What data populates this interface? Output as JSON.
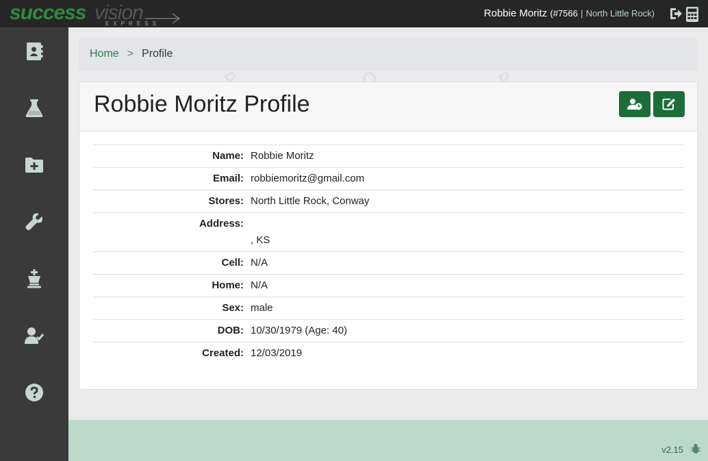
{
  "brand": {
    "logo_part1": "success",
    "logo_part2": "vision",
    "logo_sub": "EXPRESS"
  },
  "header": {
    "user_name": "Robbie Moritz",
    "user_number": "(#7566",
    "separator": "|",
    "store": "North Little Rock)",
    "icons": [
      "logout-icon",
      "calculator-icon"
    ]
  },
  "sidebar": {
    "items": [
      {
        "icon": "address-book-icon"
      },
      {
        "icon": "flask-icon"
      },
      {
        "icon": "folder-plus-icon"
      },
      {
        "icon": "wrench-icon"
      },
      {
        "icon": "chess-king-icon"
      },
      {
        "icon": "user-check-icon"
      },
      {
        "icon": "question-circle-icon"
      }
    ]
  },
  "breadcrumb": {
    "home": "Home",
    "separator": ">",
    "current": "Profile"
  },
  "profile": {
    "title": "Robbie Moritz Profile",
    "buttons": {
      "history_icon": "user-clock-icon",
      "edit_icon": "edit-icon"
    },
    "fields": [
      {
        "label": "Name:",
        "value": "Robbie Moritz"
      },
      {
        "label": "Email:",
        "value": "robbiemoritz@gmail.com"
      },
      {
        "label": "Stores:",
        "value": "North Little Rock, Conway"
      },
      {
        "label": "Address:",
        "value": ", KS"
      },
      {
        "label": "Cell:",
        "value": "N/A"
      },
      {
        "label": "Home:",
        "value": "N/A"
      },
      {
        "label": "Sex:",
        "value": "male"
      },
      {
        "label": "DOB:",
        "value": "10/30/1979 (Age: 40)"
      },
      {
        "label": "Created:",
        "value": "12/03/2019"
      }
    ]
  },
  "footer": {
    "version": "v2.15",
    "icon": "bug-icon"
  },
  "colors": {
    "accent": "#1b6e3a",
    "sidebar": "#3a3a3a",
    "topbar": "#262626",
    "footer": "#bcd9ca"
  }
}
